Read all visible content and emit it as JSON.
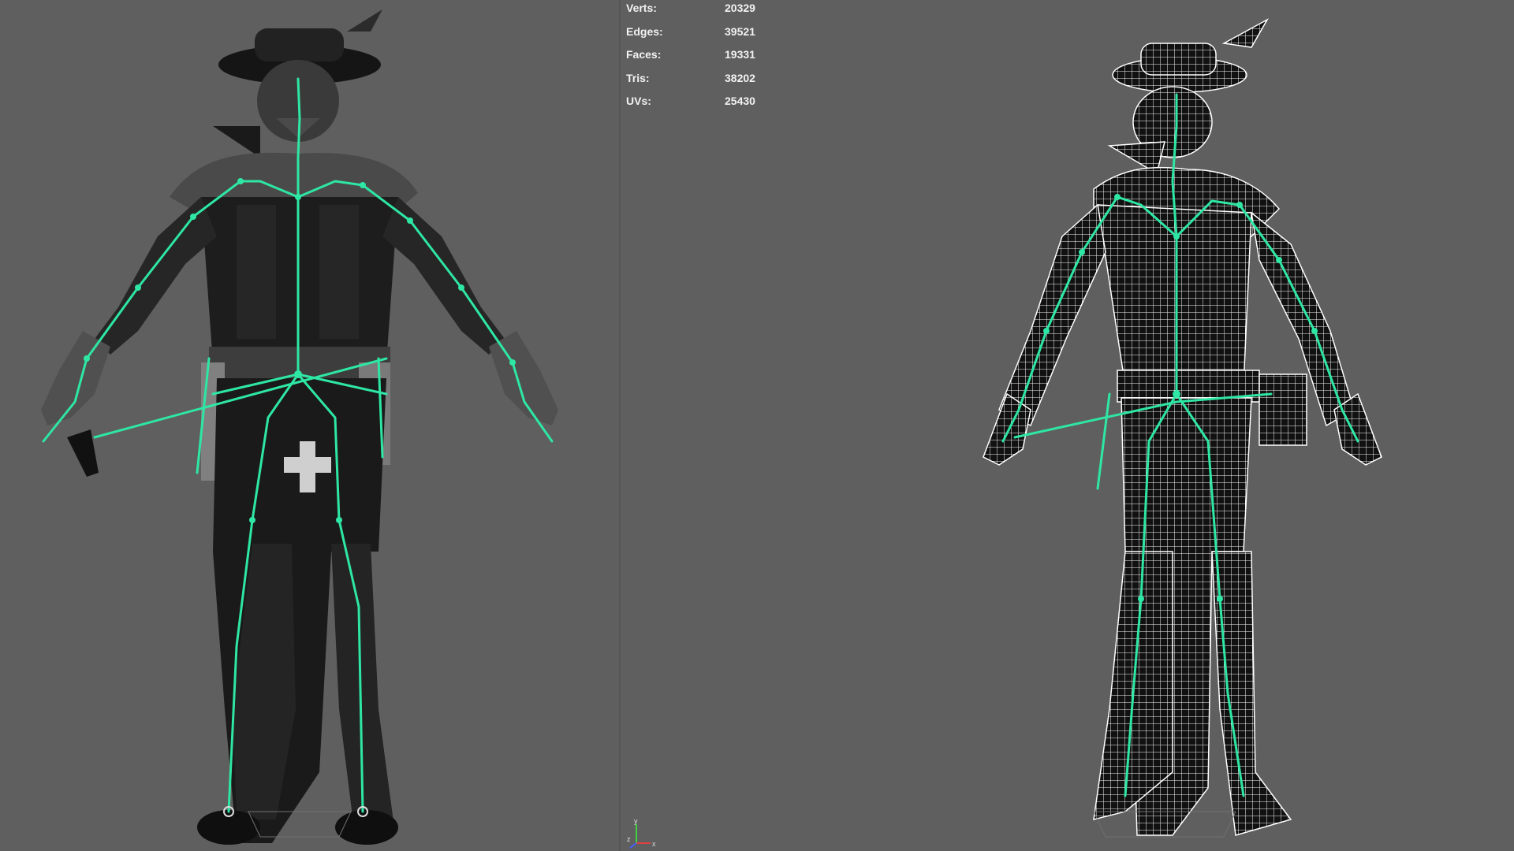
{
  "stats": [
    {
      "label": "Verts:",
      "value": "20329"
    },
    {
      "label": "Edges:",
      "value": "39521"
    },
    {
      "label": "Faces:",
      "value": "19331"
    },
    {
      "label": "Tris:",
      "value": "38202"
    },
    {
      "label": "UVs:",
      "value": "25430"
    }
  ],
  "axis": {
    "y": "y",
    "z": "z",
    "x": "x"
  },
  "icons": {
    "left_viewport_model": "shaded-character-model",
    "right_viewport_model": "wireframe-character-model",
    "skeleton": "joint-skeleton",
    "axis": "view-axis-gizmo"
  },
  "colors": {
    "viewport_bg": "#5f5f5f",
    "skeleton": "#2ee7a4",
    "wireframe": "#ffffff",
    "hud_text": "#f2f2f2",
    "axis_x": "#e04040",
    "axis_y": "#40d040",
    "axis_z": "#4060ff"
  }
}
